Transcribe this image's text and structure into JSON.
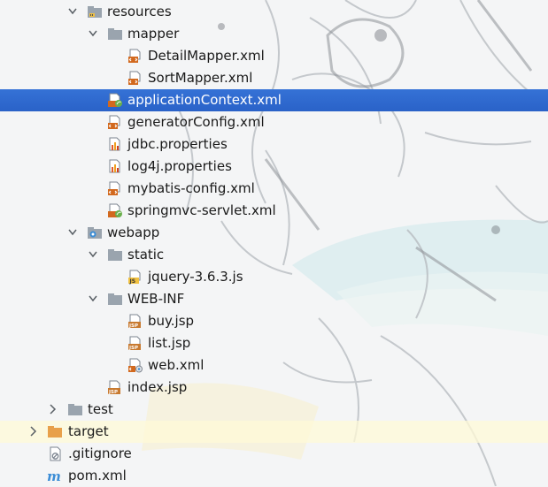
{
  "colors": {
    "selection": "#2f65ca",
    "folder": "#909aa5",
    "excluded_folder": "#e8a04a",
    "xml_badge": "#d2691e",
    "spring_badge": "#6ab04c",
    "js_badge": "#f0c040",
    "jsp_badge": "#c87a30",
    "maven": "#3b8dd6"
  },
  "tree": {
    "items": [
      {
        "label": "resources",
        "icon": "folder-resources-icon",
        "expanded": true
      },
      {
        "label": "mapper",
        "icon": "folder-icon",
        "expanded": true
      },
      {
        "label": "DetailMapper.xml",
        "icon": "xml-file-icon"
      },
      {
        "label": "SortMapper.xml",
        "icon": "xml-file-icon"
      },
      {
        "label": "applicationContext.xml",
        "icon": "spring-xml-file-icon",
        "selected": true
      },
      {
        "label": "generatorConfig.xml",
        "icon": "xml-file-icon"
      },
      {
        "label": "jdbc.properties",
        "icon": "properties-file-icon"
      },
      {
        "label": "log4j.properties",
        "icon": "properties-file-icon"
      },
      {
        "label": "mybatis-config.xml",
        "icon": "xml-file-icon"
      },
      {
        "label": "springmvc-servlet.xml",
        "icon": "spring-xml-file-icon"
      },
      {
        "label": "webapp",
        "icon": "web-folder-icon",
        "expanded": true
      },
      {
        "label": "static",
        "icon": "folder-icon",
        "expanded": true
      },
      {
        "label": "jquery-3.6.3.js",
        "icon": "js-file-icon"
      },
      {
        "label": "WEB-INF",
        "icon": "folder-icon",
        "expanded": true
      },
      {
        "label": "buy.jsp",
        "icon": "jsp-file-icon"
      },
      {
        "label": "list.jsp",
        "icon": "jsp-file-icon"
      },
      {
        "label": "web.xml",
        "icon": "web-xml-file-icon"
      },
      {
        "label": "index.jsp",
        "icon": "jsp-file-icon"
      },
      {
        "label": "test",
        "icon": "folder-icon",
        "expanded": false
      },
      {
        "label": "target",
        "icon": "excluded-folder-icon",
        "expanded": false
      },
      {
        "label": ".gitignore",
        "icon": "gitignore-file-icon"
      },
      {
        "label": "pom.xml",
        "icon": "maven-icon"
      }
    ]
  }
}
